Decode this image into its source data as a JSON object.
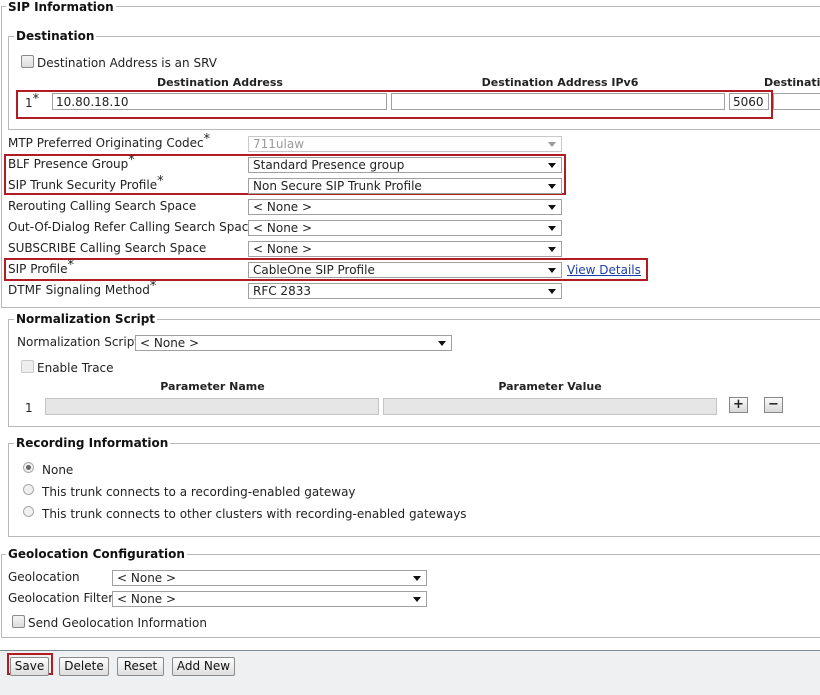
{
  "sip_info": {
    "legend": "SIP Information",
    "destination": {
      "legend": "Destination",
      "srv_label": "Destination Address is an SRV",
      "col_address": "Destination Address",
      "col_ipv6": "Destination Address IPv6",
      "col_port": "Destinatio",
      "row_index": "1",
      "address_value": "10.80.18.10",
      "ipv6_value": "",
      "port_value": "5060"
    },
    "fields": {
      "mtp_label": "MTP Preferred Originating Codec",
      "mtp_value": "711ulaw",
      "blf_label": "BLF Presence Group",
      "blf_value": "Standard Presence group",
      "security_label": "SIP Trunk Security Profile",
      "security_value": "Non Secure SIP Trunk Profile",
      "rerouting_label": "Rerouting Calling Search Space",
      "rerouting_value": "< None >",
      "ood_label": "Out-Of-Dialog Refer Calling Search Space",
      "ood_value": "< None >",
      "subscribe_label": "SUBSCRIBE Calling Search Space",
      "subscribe_value": "< None >",
      "sip_profile_label": "SIP Profile",
      "sip_profile_value": "CableOne SIP Profile",
      "view_details": "View Details",
      "dtmf_label": "DTMF Signaling Method",
      "dtmf_value": "RFC 2833"
    },
    "required_mark": "*"
  },
  "normalization": {
    "legend": "Normalization Script",
    "script_label": "Normalization Script",
    "script_value": "< None >",
    "enable_trace": "Enable Trace",
    "col_param_name": "Parameter Name",
    "col_param_value": "Parameter Value",
    "row_index": "1",
    "add_symbol": "+",
    "remove_symbol": "−"
  },
  "recording": {
    "legend": "Recording Information",
    "options": [
      "None",
      "This trunk connects to a recording-enabled gateway",
      "This trunk connects to other clusters with recording-enabled gateways"
    ],
    "selected": "None"
  },
  "geolocation": {
    "legend": "Geolocation Configuration",
    "geo_label": "Geolocation",
    "geo_value": "< None >",
    "filter_label": "Geolocation Filter",
    "filter_value": "< None >",
    "send_label": "Send Geolocation Information"
  },
  "actions": {
    "save": "Save",
    "delete": "Delete",
    "reset": "Reset",
    "add_new": "Add New"
  },
  "colors": {
    "highlight": "#b11c22",
    "link": "#1a3fa8"
  }
}
